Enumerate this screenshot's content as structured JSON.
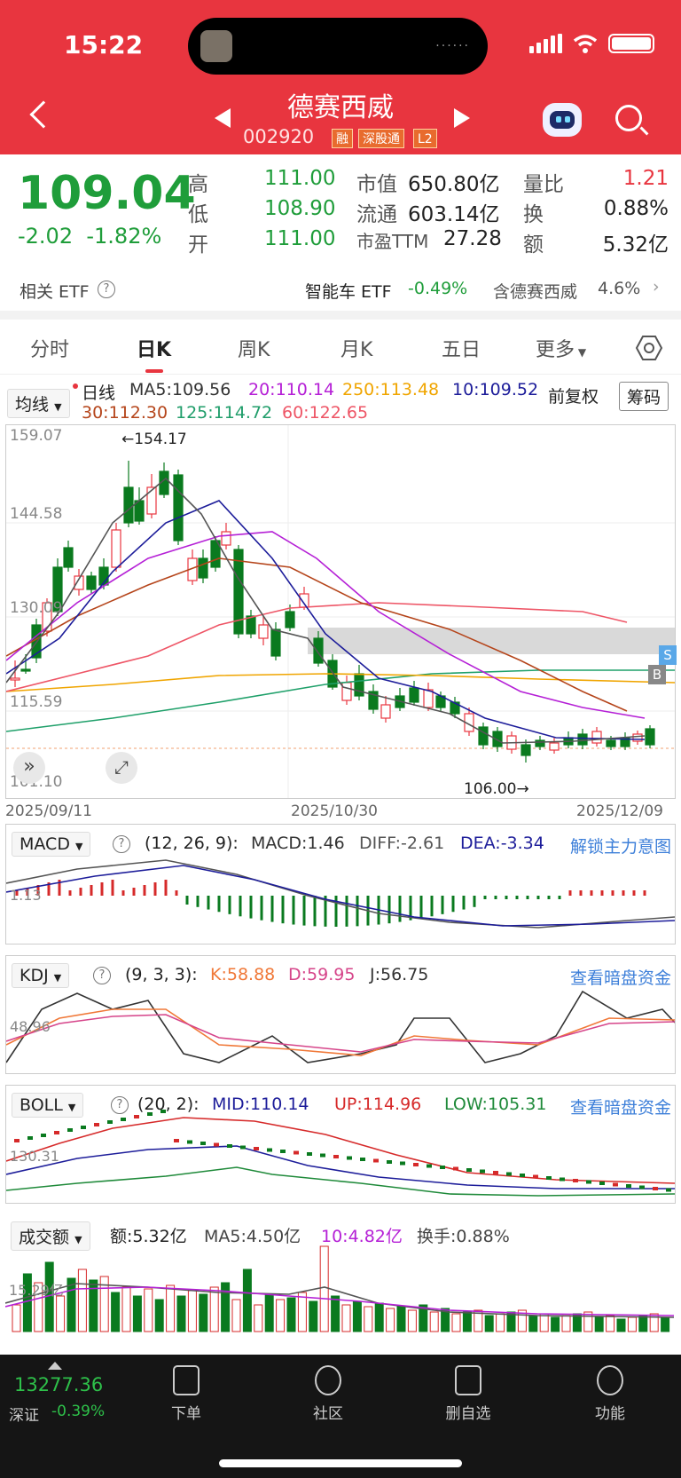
{
  "status": {
    "time": "15:22"
  },
  "header": {
    "title": "德赛西威",
    "code": "002920",
    "badges": [
      "融",
      "深股通",
      "L2"
    ]
  },
  "quote": {
    "price": "109.04",
    "change": "-2.02",
    "change_pct": "-1.82%",
    "high_label": "高",
    "high": "111.00",
    "low_label": "低",
    "low": "108.90",
    "open_label": "开",
    "open": "111.00",
    "mktcap_label": "市值",
    "mktcap": "650.80亿",
    "float_label": "流通",
    "float": "603.14亿",
    "pe_label": "市盈TTM",
    "pe": "27.28",
    "vr_label": "量比",
    "vr": "1.21",
    "turn_label": "换",
    "turn": "0.88%",
    "amt_label": "额",
    "amt": "5.32亿"
  },
  "etf": {
    "label": "相关 ETF",
    "name": "智能车 ETF",
    "change": "-0.49%",
    "hold_text": "含德赛西威",
    "hold_pct": "4.6%"
  },
  "tabs": [
    "分时",
    "日K",
    "周K",
    "月K",
    "五日",
    "更多"
  ],
  "ma_legend": {
    "selector": "均线",
    "period": "日线",
    "ma5": "MA5:109.56",
    "ma20": "20:110.14",
    "ma250": "250:113.48",
    "ma10": "10:109.52",
    "ma30": "30:112.30",
    "ma125": "125:114.72",
    "ma60": "60:122.65",
    "adjust": "前复权",
    "chips": "筹码"
  },
  "kchart": {
    "y_ticks": [
      "159.07",
      "144.58",
      "130.09",
      "115.59",
      "101.10"
    ],
    "dates": [
      "2025/09/11",
      "2025/10/30",
      "2025/12/09"
    ],
    "max_label": "154.17",
    "min_label": "106.00",
    "marker_b": "B",
    "marker_s": "S"
  },
  "macd": {
    "name": "MACD",
    "params": "(12, 26, 9):",
    "macd": "MACD:1.46",
    "diff": "DIFF:-2.61",
    "dea": "DEA:-3.34",
    "link": "解锁主力意图",
    "tick": "1.13"
  },
  "kdj": {
    "name": "KDJ",
    "params": "(9, 3, 3):",
    "k": "K:58.88",
    "d": "D:59.95",
    "j": "J:56.75",
    "link": "查看暗盘资金",
    "tick": "48.96"
  },
  "boll": {
    "name": "BOLL",
    "params": "(20, 2):",
    "mid": "MID:110.14",
    "up": "UP:114.96",
    "low": "LOW:105.31",
    "link": "查看暗盘资金",
    "tick": "130.31"
  },
  "vol": {
    "name": "成交额",
    "amt": "额:5.32亿",
    "ma5": "MA5:4.50亿",
    "ma10": "10:4.82亿",
    "turn": "换手:0.88%",
    "tick": "15.29亿"
  },
  "bottom": {
    "index_value": "13277.36",
    "index_name": "深证",
    "index_change": "-0.39%",
    "nav": [
      "下单",
      "社区",
      "删自选",
      "功能"
    ]
  }
}
